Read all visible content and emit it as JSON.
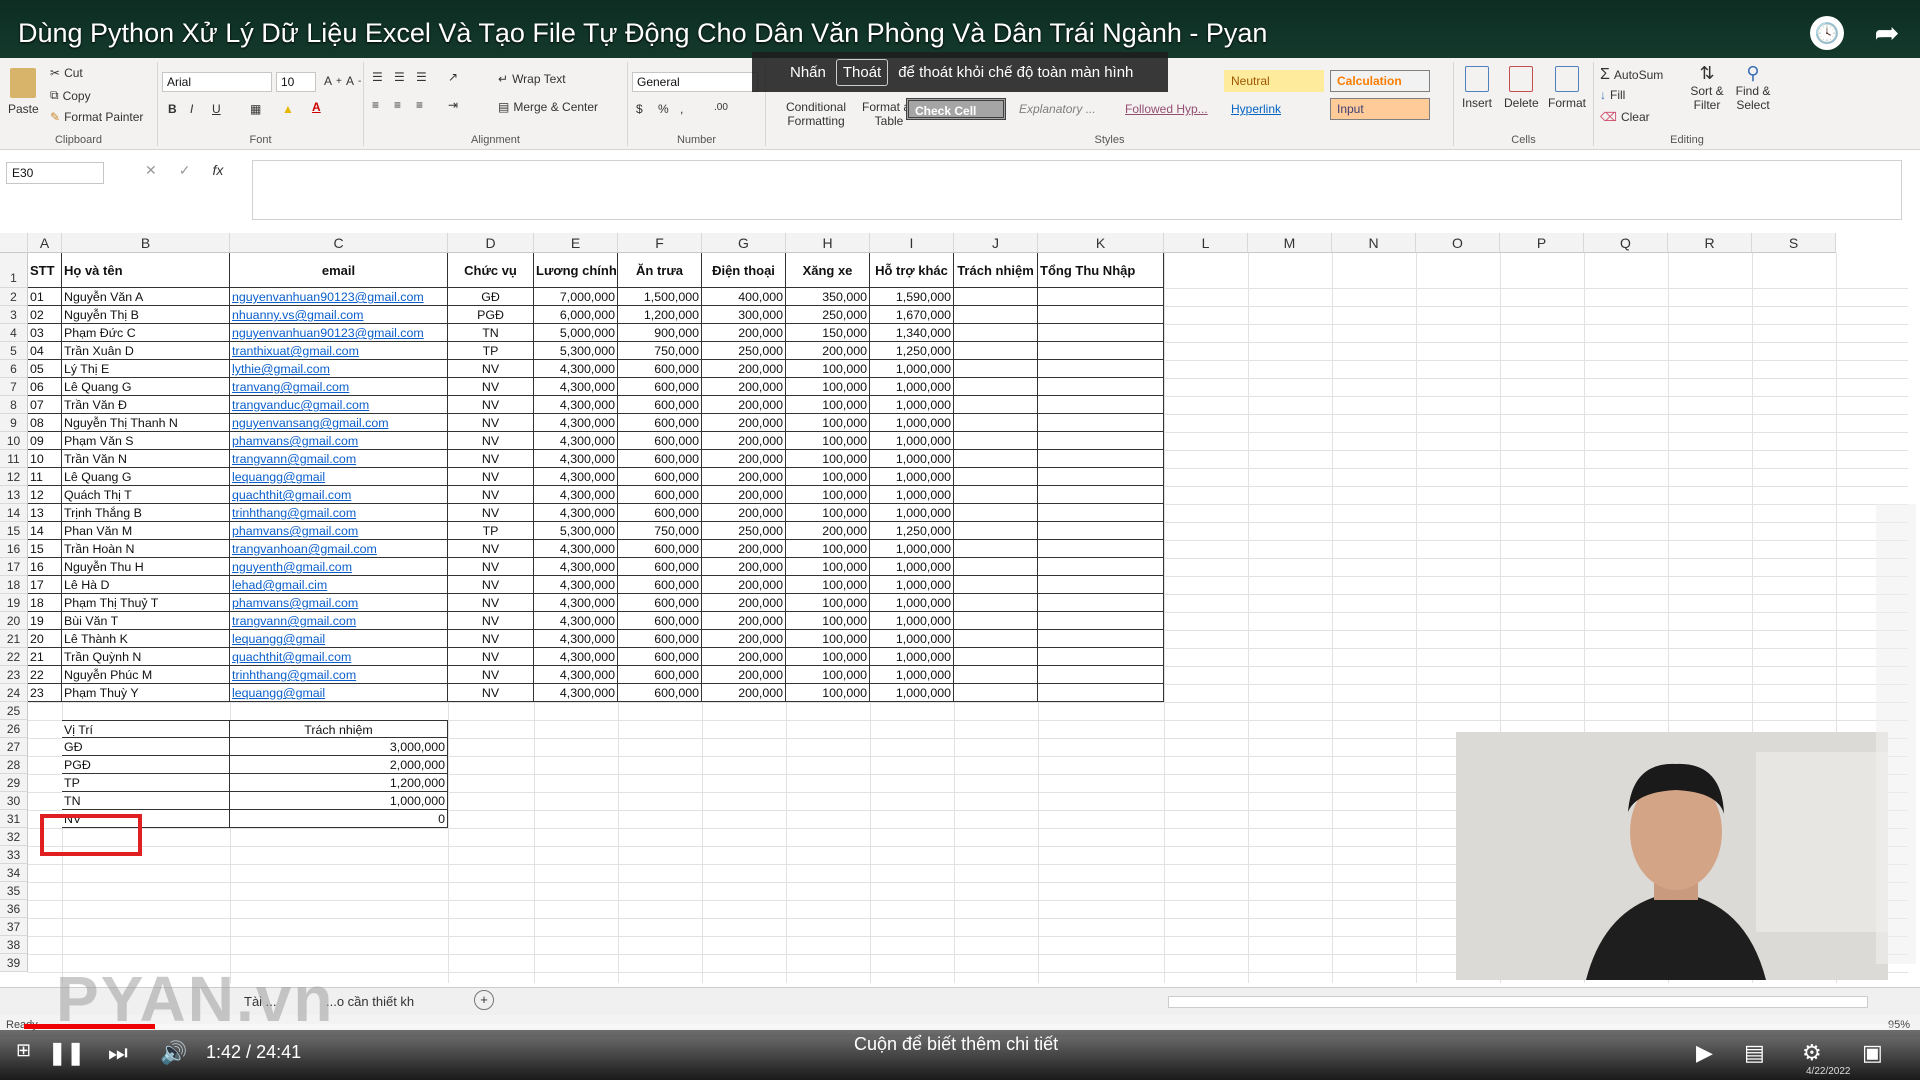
{
  "video": {
    "title": "Dùng Python Xử Lý Dữ Liệu Excel Và Tạo File Tự Động Cho Dân Văn Phòng Và Dân Trái Ngành - Pyan",
    "fullscreen_toast": {
      "pre": "Nhấn",
      "key": "Thoát",
      "post": "để thoát khỏi chế độ toàn màn hình"
    },
    "time_current": "1:42",
    "time_total": "24:41",
    "scroll_hint": "Cuộn để biết thêm chi tiết",
    "progress": 0.07,
    "watermark": "PYAN.vn"
  },
  "ribbon": {
    "clipboard": {
      "paste": "Paste",
      "cut": "Cut",
      "copy": "Copy",
      "format_painter": "Format Painter",
      "label": "Clipboard"
    },
    "font": {
      "family": "Arial",
      "size": "10",
      "label": "Font"
    },
    "alignment": {
      "wrap_text": "Wrap Text",
      "merge_center": "Merge & Center",
      "label": "Alignment"
    },
    "number": {
      "format": "General",
      "label": "Number"
    },
    "styles": {
      "conditional": "Conditional Formatting",
      "format_as_table": "Format as Table",
      "neutral": "Neutral",
      "calculation": "Calculation",
      "check_cell": "Check Cell",
      "explanatory": "Explanatory ...",
      "followed_hyp": "Followed Hyp...",
      "hyperlink": "Hyperlink",
      "input": "Input",
      "label": "Styles"
    },
    "cells": {
      "insert": "Insert",
      "delete": "Delete",
      "format": "Format",
      "label": "Cells"
    },
    "editing": {
      "autosum": "AutoSum",
      "fill": "Fill",
      "clear": "Clear",
      "sort": "Sort & Filter",
      "find": "Find & Select",
      "label": "Editing"
    }
  },
  "formula_bar": {
    "name_box": "E30",
    "fx": "fx"
  },
  "columns": [
    "A",
    "B",
    "C",
    "D",
    "E",
    "F",
    "G",
    "H",
    "I",
    "J",
    "K",
    "L",
    "M",
    "N",
    "O",
    "P",
    "Q",
    "R",
    "S"
  ],
  "headers": [
    "STT",
    "Họ và tên",
    "email",
    "Chức vụ",
    "Lương chính",
    "Ăn trưa",
    "Điện thoại",
    "Xăng xe",
    "Hỗ trợ khác",
    "Trách nhiệm",
    "Tổng Thu Nhập"
  ],
  "employees": [
    [
      "01",
      "Nguyễn Văn A",
      "nguyenvanhuan90123@gmail.com",
      "GĐ",
      "7,000,000",
      "1,500,000",
      "400,000",
      "350,000",
      "1,590,000"
    ],
    [
      "02",
      "Nguyễn Thị B",
      "nhuanny.vs@gmail.com",
      "PGĐ",
      "6,000,000",
      "1,200,000",
      "300,000",
      "250,000",
      "1,670,000"
    ],
    [
      "03",
      "Phạm Đức C",
      "nguyenvanhuan90123@gmail.com",
      "TN",
      "5,000,000",
      "900,000",
      "200,000",
      "150,000",
      "1,340,000"
    ],
    [
      "04",
      "Trần Xuân D",
      "tranthixuat@gmail.com",
      "TP",
      "5,300,000",
      "750,000",
      "250,000",
      "200,000",
      "1,250,000"
    ],
    [
      "05",
      "Lý Thị E",
      "lythie@gmail.com",
      "NV",
      "4,300,000",
      "600,000",
      "200,000",
      "100,000",
      "1,000,000"
    ],
    [
      "06",
      "Lê Quang G",
      "tranvang@gmail.com",
      "NV",
      "4,300,000",
      "600,000",
      "200,000",
      "100,000",
      "1,000,000"
    ],
    [
      "07",
      "Trần Văn Đ",
      "trangvanduc@gmail.com",
      "NV",
      "4,300,000",
      "600,000",
      "200,000",
      "100,000",
      "1,000,000"
    ],
    [
      "08",
      "Nguyễn Thị Thanh N",
      "nguyenvansang@gmail.com",
      "NV",
      "4,300,000",
      "600,000",
      "200,000",
      "100,000",
      "1,000,000"
    ],
    [
      "09",
      "Phạm Văn S",
      "phamvans@gmail.com",
      "NV",
      "4,300,000",
      "600,000",
      "200,000",
      "100,000",
      "1,000,000"
    ],
    [
      "10",
      "Trần Văn N",
      "trangvann@gmail.com",
      "NV",
      "4,300,000",
      "600,000",
      "200,000",
      "100,000",
      "1,000,000"
    ],
    [
      "11",
      "Lê Quang G",
      "lequangg@gmail",
      "NV",
      "4,300,000",
      "600,000",
      "200,000",
      "100,000",
      "1,000,000"
    ],
    [
      "12",
      "Quách Thị T",
      "quachthit@gmail.com",
      "NV",
      "4,300,000",
      "600,000",
      "200,000",
      "100,000",
      "1,000,000"
    ],
    [
      "13",
      "Trịnh Thắng B",
      "trinhthang@gmail.com",
      "NV",
      "4,300,000",
      "600,000",
      "200,000",
      "100,000",
      "1,000,000"
    ],
    [
      "14",
      "Phan Văn M",
      "phamvans@gmail.com",
      "TP",
      "5,300,000",
      "750,000",
      "250,000",
      "200,000",
      "1,250,000"
    ],
    [
      "15",
      "Trần Hoàn N",
      "trangvanhoan@gmail.com",
      "NV",
      "4,300,000",
      "600,000",
      "200,000",
      "100,000",
      "1,000,000"
    ],
    [
      "16",
      "Nguyễn Thu H",
      "nguyenth@gmail.com",
      "NV",
      "4,300,000",
      "600,000",
      "200,000",
      "100,000",
      "1,000,000"
    ],
    [
      "17",
      "Lê Hà D",
      "lehad@gmail.cim",
      "NV",
      "4,300,000",
      "600,000",
      "200,000",
      "100,000",
      "1,000,000"
    ],
    [
      "18",
      "Phạm Thị Thuỷ T",
      "phamvans@gmail.com",
      "NV",
      "4,300,000",
      "600,000",
      "200,000",
      "100,000",
      "1,000,000"
    ],
    [
      "19",
      "Bùi Văn T",
      "trangvann@gmail.com",
      "NV",
      "4,300,000",
      "600,000",
      "200,000",
      "100,000",
      "1,000,000"
    ],
    [
      "20",
      "Lê Thành K",
      "lequangg@gmail",
      "NV",
      "4,300,000",
      "600,000",
      "200,000",
      "100,000",
      "1,000,000"
    ],
    [
      "21",
      "Trần Quỳnh N",
      "quachthit@gmail.com",
      "NV",
      "4,300,000",
      "600,000",
      "200,000",
      "100,000",
      "1,000,000"
    ],
    [
      "22",
      "Nguyễn Phúc M",
      "trinhthang@gmail.com",
      "NV",
      "4,300,000",
      "600,000",
      "200,000",
      "100,000",
      "1,000,000"
    ],
    [
      "23",
      "Phạm Thuỳ Y",
      "lequangg@gmail",
      "NV",
      "4,300,000",
      "600,000",
      "200,000",
      "100,000",
      "1,000,000"
    ]
  ],
  "lookup": {
    "headers": [
      "Vị Trí",
      "Trách nhiệm"
    ],
    "rows": [
      [
        "GĐ",
        "3,000,000"
      ],
      [
        "PGĐ",
        "2,000,000"
      ],
      [
        "TP",
        "1,200,000"
      ],
      [
        "TN",
        "1,000,000"
      ],
      [
        "NV",
        "0"
      ]
    ]
  },
  "sheet_tabs": [
    "Tài ...",
    "...o cần thiết kh"
  ],
  "status": {
    "ready": "Ready",
    "zoom": "95%"
  },
  "taskbar_date": "4/22/2022"
}
